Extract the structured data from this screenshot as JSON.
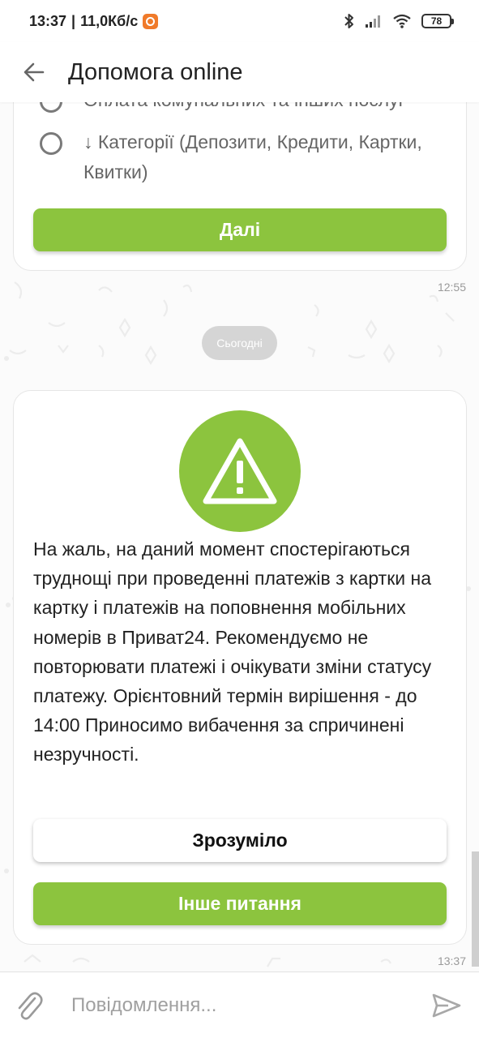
{
  "status_bar": {
    "time": "13:37",
    "speed": "11,0Кб/с",
    "battery": "78",
    "icons": [
      "app-notification-icon",
      "bluetooth-icon",
      "signal-icon",
      "wifi-icon",
      "battery-icon"
    ]
  },
  "app_bar": {
    "title": "Допомога online",
    "back_icon": "arrow-left-icon"
  },
  "chat": {
    "messages": [
      {
        "options": [
          "Оплата комунальних та інших послуг",
          "↓ Категорії (Депозити, Кредити, Картки, Квитки)"
        ],
        "button": "Далі",
        "time": "12:55"
      }
    ],
    "date_separator": "Сьогодні",
    "alert": {
      "icon": "warning-triangle-icon",
      "text": "На жаль, на даний момент спостерігаються труднощі при проведенні платежів з картки на картку і платежів на поповнення мобільних номерів в Приват24. Рекомендуємо не повторювати платежі і очікувати зміни статусу платежу. Орієнтовний термін вирішення - до 14:00 Приносимо вибачення за спричинені незручності.",
      "button_ok": "Зрозуміло",
      "button_other": "Інше питання",
      "time": "13:37"
    }
  },
  "input_bar": {
    "placeholder": "Повідомлення...",
    "value": "",
    "attach_icon": "paperclip-icon",
    "send_icon": "send-icon"
  },
  "colors": {
    "accent": "#8cc43e",
    "chip": "#d5d5d5",
    "background": "#fbfbfb"
  }
}
